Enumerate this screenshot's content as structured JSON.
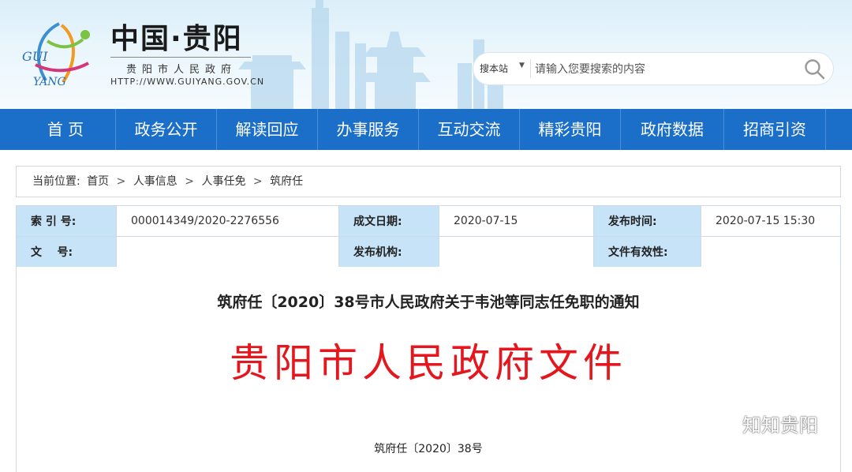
{
  "header": {
    "title": "中国·贵阳",
    "subtitle": "贵阳市人民政府",
    "url": "HTTP://WWW.GUIYANG.GOV.CN",
    "logo_text": "GUIYANG",
    "search": {
      "scope": "搜本站",
      "placeholder": "请输入您要搜索的内容"
    }
  },
  "nav": {
    "items": [
      "首 页",
      "政务公开",
      "解读回应",
      "办事服务",
      "互动交流",
      "精彩贵阳",
      "政府数据",
      "招商引资"
    ]
  },
  "breadcrumb": {
    "label": "当前位置:",
    "items": [
      "首页",
      "人事信息",
      "人事任免",
      "筑府任"
    ],
    "separator": ">"
  },
  "meta": {
    "index_label": "索 引 号:",
    "index_value": "000014349/2020-2276556",
    "created_label": "成文日期:",
    "created_value": "2020-07-15",
    "published_label": "发布时间:",
    "published_value": "2020-07-15 15:30",
    "doc_no_label": "文    号:",
    "doc_no_value": "",
    "org_label": "发布机构:",
    "org_value": "",
    "validity_label": "文件有效性:",
    "validity_value": ""
  },
  "content": {
    "title": "筑府任〔2020〕38号市人民政府关于韦池等同志任免职的通知",
    "doc_header": "贵阳市人民政府文件",
    "doc_number": "筑府任〔2020〕38号"
  },
  "watermark": {
    "text": "知知贵阳"
  },
  "colors": {
    "nav_blue": "#1b6fc9",
    "meta_label_bg": "#c6e3f7",
    "doc_red": "#e5171e"
  }
}
